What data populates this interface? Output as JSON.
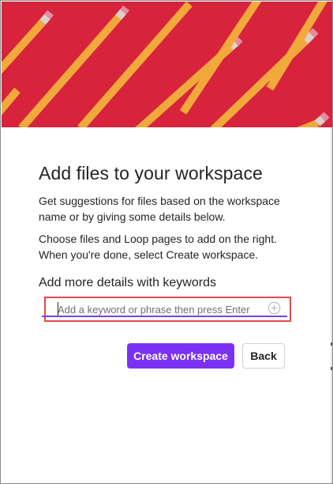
{
  "dialog": {
    "title": "Add files to your workspace",
    "description_1": "Get suggestions for files based on the workspace name or by giving some details below.",
    "description_2": "Choose files and Loop pages to add on the right. When you're done, select Create workspace.",
    "keywords_heading": "Add more details with keywords",
    "keyword_input": {
      "value": "",
      "placeholder": "Add a keyword or phrase then press Enter"
    },
    "add_icon": "add-circle-icon",
    "create_button_label": "Create workspace",
    "back_button_label": "Back"
  },
  "hero_image": {
    "subject": "pencils on red background",
    "background_color": "#d8233d"
  },
  "colors": {
    "accent": "#7b31f4",
    "highlight_border": "#e24b4b",
    "text": "#242424"
  }
}
